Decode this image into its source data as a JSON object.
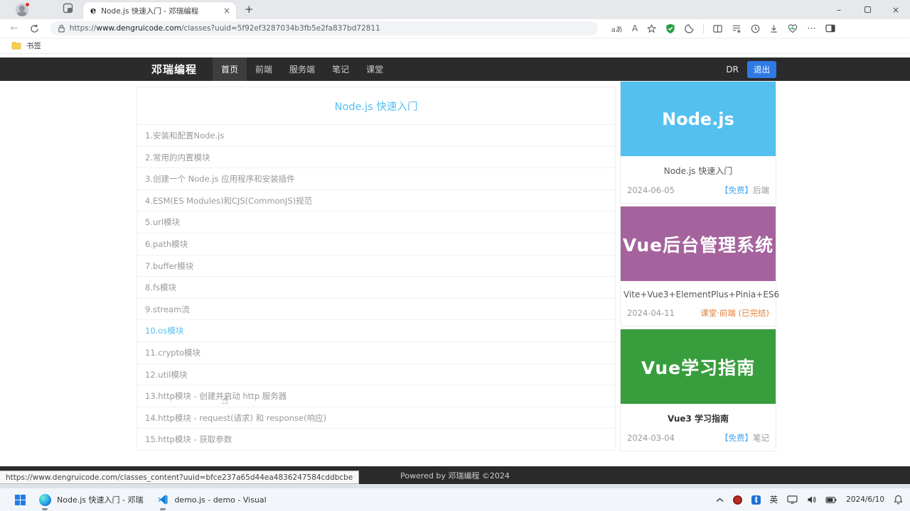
{
  "browser": {
    "tab_title": "Node.js 快速入门 - 邓瑞编程",
    "close_glyph": "×",
    "newtab_glyph": "+",
    "back_glyph": "←",
    "minimize_glyph": "–",
    "url": {
      "scheme": "https://",
      "domain": "www.dengruicode.com",
      "path": "/classes?uuid=5f92ef3287034b3fb5e2fa837bd72811"
    },
    "translate_icon_text": "aあ",
    "readaloud_icon_text": "A",
    "more_icon_text": "⋯",
    "bookmarks_label": "书签"
  },
  "site": {
    "brand": "邓瑞编程",
    "nav": [
      {
        "label": "首页"
      },
      {
        "label": "前端"
      },
      {
        "label": "服务端"
      },
      {
        "label": "笔记"
      },
      {
        "label": "课堂"
      }
    ],
    "user_initials": "DR",
    "logout_label": "退出",
    "accent_blue": "#54c0f0"
  },
  "content": {
    "title": "Node.js 快速入门",
    "lessons": [
      {
        "label": "1.安装和配置Node.js"
      },
      {
        "label": "2.常用的内置模块"
      },
      {
        "label": "3.创建一个 Node.js 应用程序和安装插件"
      },
      {
        "label": "4.ESM(ES Modules)和CJS(CommonJS)规范"
      },
      {
        "label": "5.url模块"
      },
      {
        "label": "6.path模块"
      },
      {
        "label": "7.buffer模块"
      },
      {
        "label": "8.fs模块"
      },
      {
        "label": "9.stream流"
      },
      {
        "label": "10.os模块"
      },
      {
        "label": "11.crypto模块"
      },
      {
        "label": "12.util模块"
      },
      {
        "label": "13.http模块 - 创建并启动 http 服务器"
      },
      {
        "label": "14.http模块 - request(请求) 和 response(响应)"
      },
      {
        "label": "15.http模块 - 获取参数"
      }
    ],
    "cursor_glyph": "☝"
  },
  "sidebar": {
    "cards": [
      {
        "banner": "Node.js",
        "banner_color": "#54c0f0",
        "title": "Node.js 快速入门",
        "date": "2024-06-05",
        "tag_blue": "【免费】",
        "tag_gray": "后端",
        "tag_orange": ""
      },
      {
        "banner": "Vue后台管理系统",
        "banner_color": "#a5639e",
        "title": "Vite+Vue3+ElementPlus+Pinia+ES6",
        "date": "2024-04-11",
        "tag_blue": "",
        "tag_gray": "",
        "tag_orange": "课堂·前端 (已完结)"
      },
      {
        "banner": "Vue学习指南",
        "banner_color": "#389e3d",
        "title": "Vue3 学习指南",
        "date": "2024-03-04",
        "tag_blue": "【免费】",
        "tag_gray": "笔记",
        "tag_orange": ""
      }
    ]
  },
  "footer": {
    "text": "Powered by 邓瑞编程 ©2024"
  },
  "statusbar": {
    "link": "https://www.dengruicode.com/classes_content?uuid=bfce237a65d44ea4836247584cddbcbe"
  },
  "taskbar": {
    "apps": [
      {
        "label": "Node.js 快速入门 - 邓瑞"
      },
      {
        "label": "demo.js - demo - Visual"
      }
    ],
    "tray": {
      "ime": "英",
      "date": "2024/6/10"
    }
  }
}
